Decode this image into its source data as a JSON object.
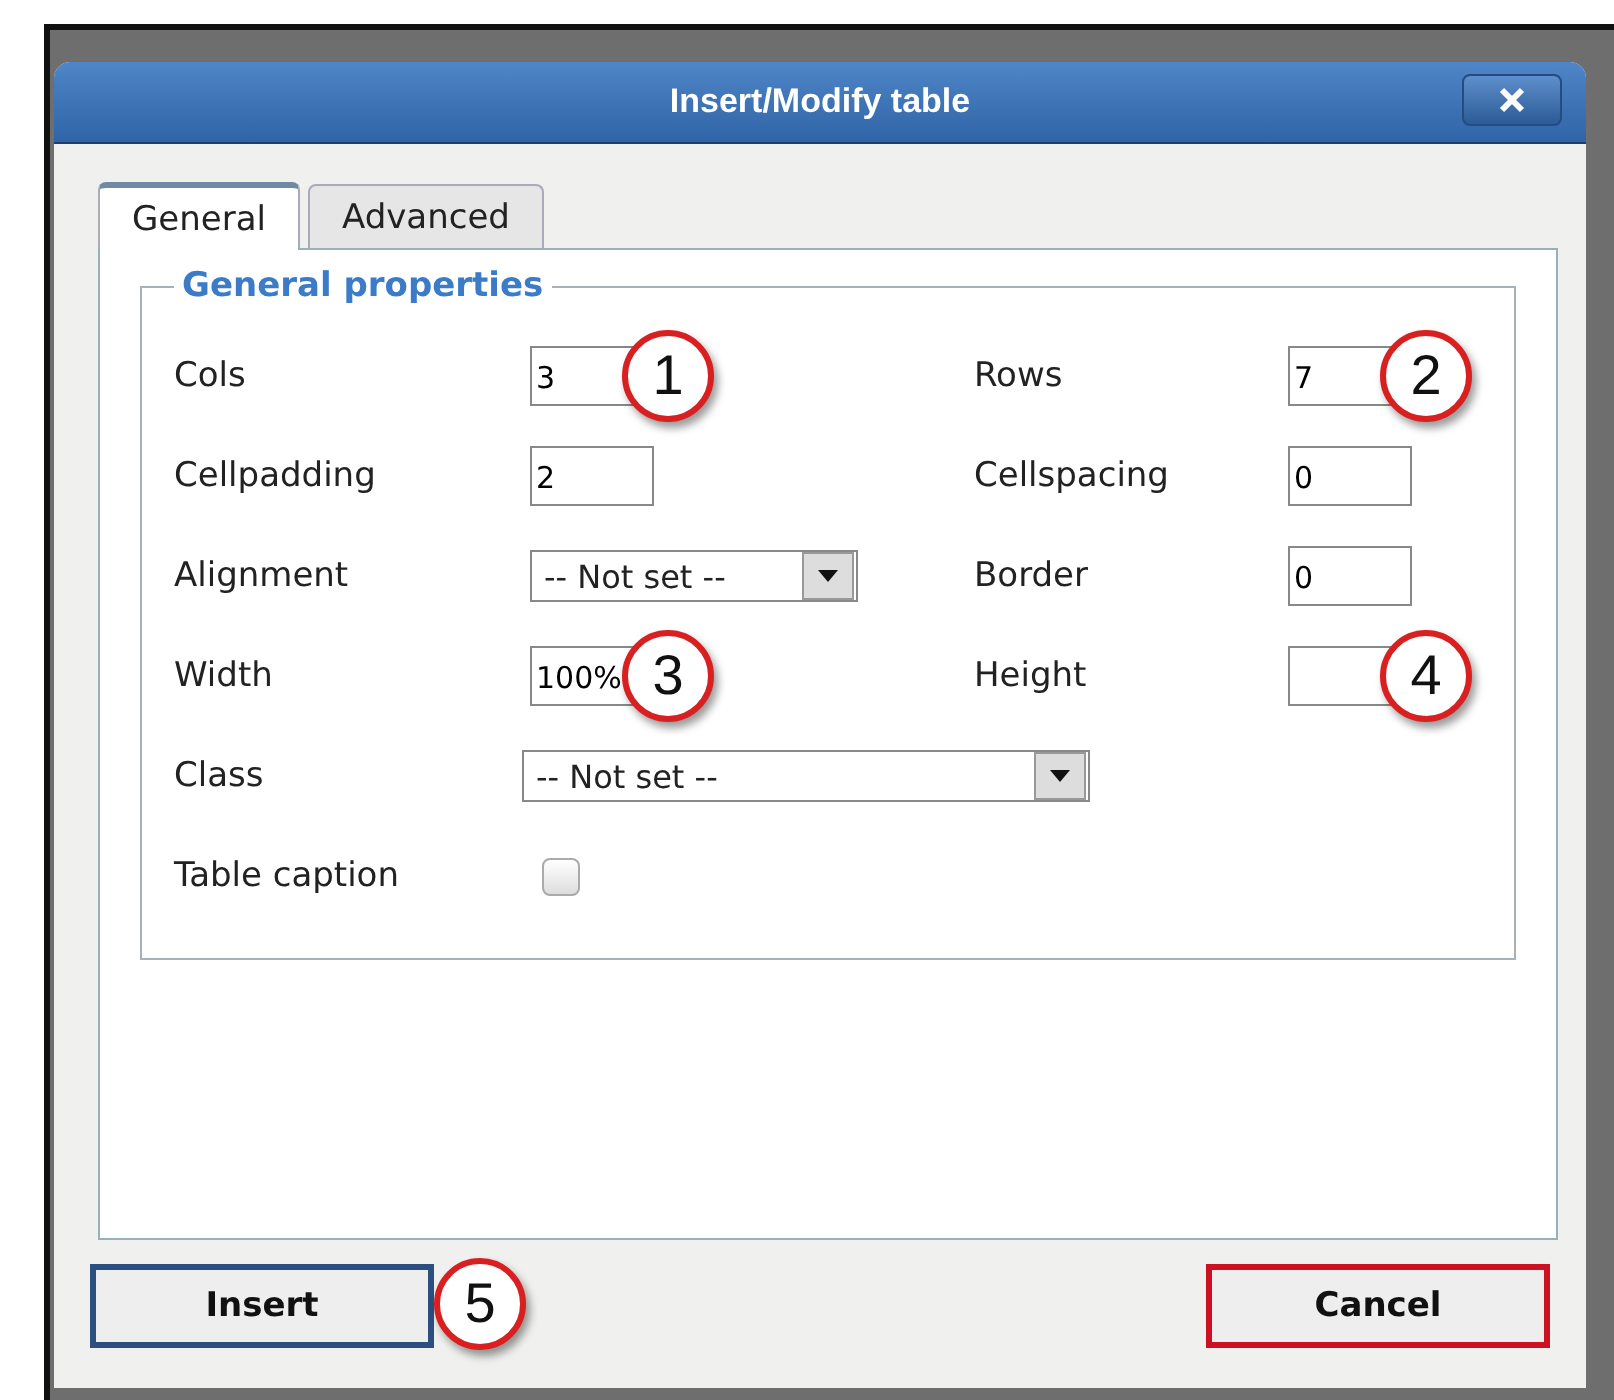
{
  "dialog": {
    "title": "Insert/Modify table",
    "tabs": [
      {
        "label": "General",
        "selected": true
      },
      {
        "label": "Advanced",
        "selected": false
      }
    ],
    "legend": "General properties",
    "rows": [
      {
        "left": {
          "label": "Cols",
          "kind": "text",
          "value": "3",
          "callout": "1"
        },
        "right": {
          "label": "Rows",
          "kind": "text",
          "value": "7",
          "callout": "2"
        }
      },
      {
        "left": {
          "label": "Cellpadding",
          "kind": "text",
          "value": "2"
        },
        "right": {
          "label": "Cellspacing",
          "kind": "text",
          "value": "0"
        }
      },
      {
        "left": {
          "label": "Alignment",
          "kind": "select",
          "value": "-- Not set --"
        },
        "right": {
          "label": "Border",
          "kind": "text",
          "value": "0"
        }
      },
      {
        "left": {
          "label": "Width",
          "kind": "text",
          "value": "100%",
          "callout": "3"
        },
        "right": {
          "label": "Height",
          "kind": "text",
          "callout": "4"
        }
      },
      {
        "left": {
          "label": "Class",
          "kind": "wideselect",
          "value": "-- Not set --"
        }
      },
      {
        "left": {
          "label": "Table caption",
          "kind": "checkbox",
          "checked": false
        }
      }
    ],
    "buttons": [
      {
        "label": "Insert",
        "kind": "primary",
        "callout": "5"
      },
      {
        "label": "Cancel",
        "kind": "cancel"
      }
    ]
  }
}
